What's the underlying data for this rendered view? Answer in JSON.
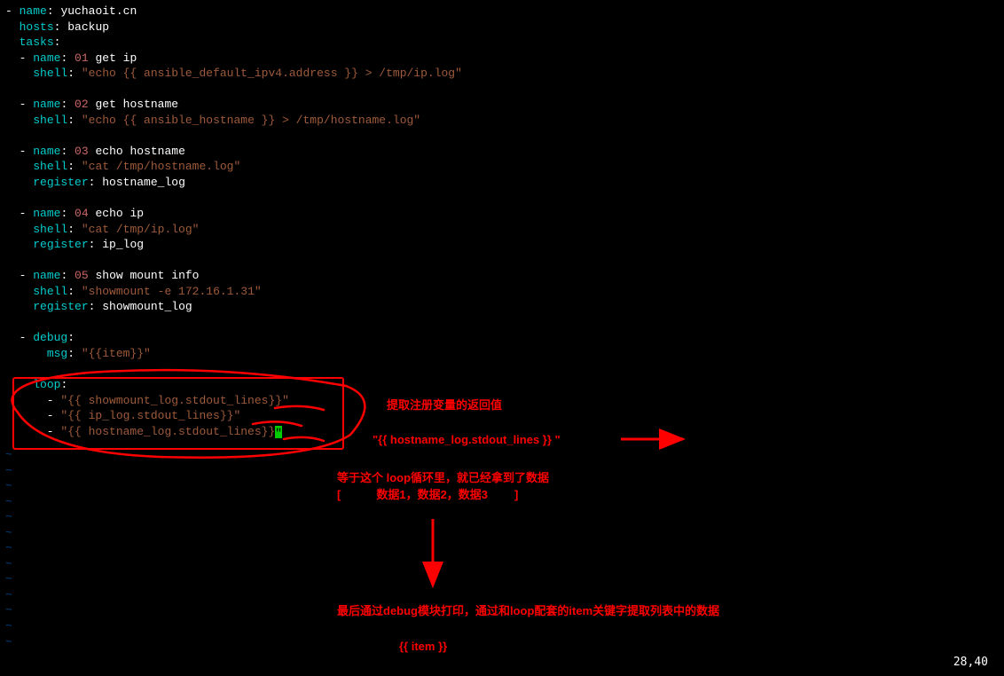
{
  "code": {
    "play_name_key": "name",
    "play_name_val": "yuchaoit.cn",
    "hosts_key": "hosts",
    "hosts_val": "backup",
    "tasks_key": "tasks",
    "task1_name_key": "name",
    "task1_num": "01",
    "task1_name_val": "get ip",
    "task1_shell_key": "shell",
    "task1_shell_val": "\"echo {{ ansible_default_ipv4.address }} > /tmp/ip.log\"",
    "task2_name_key": "name",
    "task2_num": "02",
    "task2_name_val": "get hostname",
    "task2_shell_key": "shell",
    "task2_shell_val": "\"echo {{ ansible_hostname }} > /tmp/hostname.log\"",
    "task3_name_key": "name",
    "task3_num": "03",
    "task3_name_val": "echo hostname",
    "task3_shell_key": "shell",
    "task3_shell_val": "\"cat /tmp/hostname.log\"",
    "task3_reg_key": "register",
    "task3_reg_val": "hostname_log",
    "task4_name_key": "name",
    "task4_num": "04",
    "task4_name_val": "echo ip",
    "task4_shell_key": "shell",
    "task4_shell_val": "\"cat /tmp/ip.log\"",
    "task4_reg_key": "register",
    "task4_reg_val": "ip_log",
    "task5_name_key": "name",
    "task5_num": "05",
    "task5_name_val": "show mount info",
    "task5_shell_key": "shell",
    "task5_shell_val": "\"showmount -e 172.16.1.31\"",
    "task5_reg_key": "register",
    "task5_reg_val": "showmount_log",
    "debug_key": "debug",
    "msg_key": "msg",
    "msg_val": "\"{{item}}\"",
    "loop_key": "loop",
    "loop1": "\"{{ showmount_log.stdout_lines}}\"",
    "loop2": "\"{{ ip_log.stdout_lines}}\"",
    "loop3": "\"{{ hostname_log.stdout_lines}}"
  },
  "annotations": {
    "a1": "提取注册变量的返回值",
    "a2": "\"{{  hostname_log.stdout_lines }} \"",
    "a3": "等于这个 loop循环里，就已经拿到了数据",
    "a4_open": "[",
    "a4_mid": "数据1，数据2，数据3",
    "a4_close": "]",
    "a5": "最后通过debug模块打印，通过和loop配套的item关键字提取列表中的数据",
    "a6": "{{  item  }}"
  },
  "status": "28,40"
}
